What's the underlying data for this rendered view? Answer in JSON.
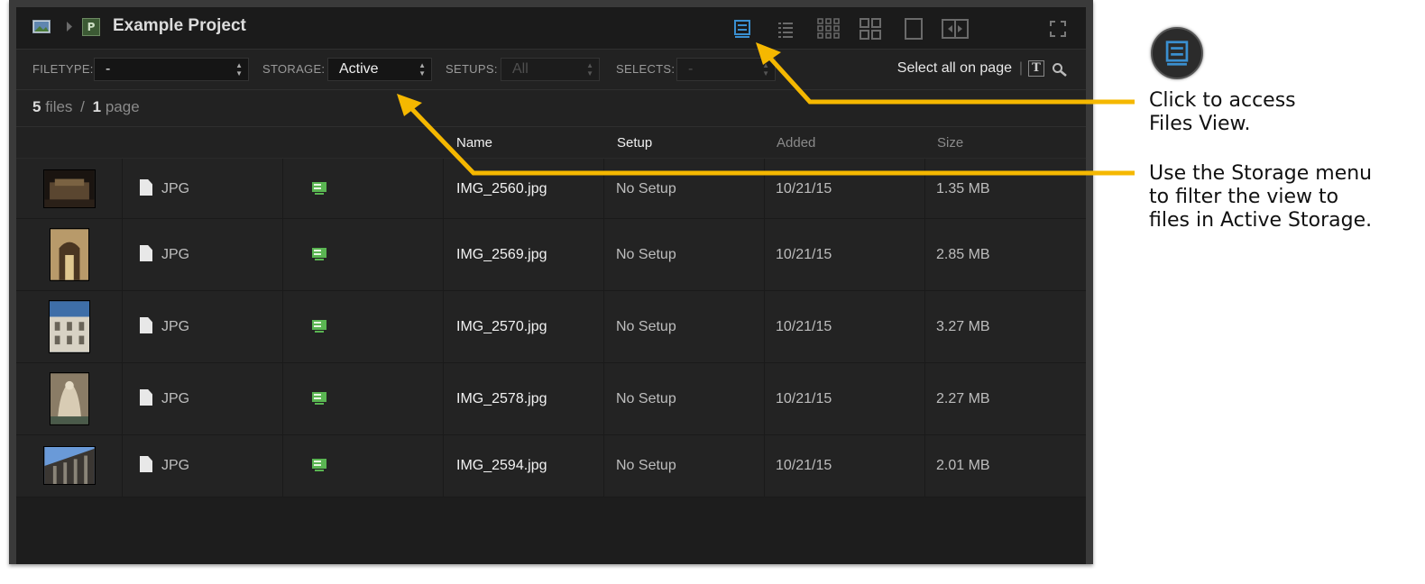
{
  "header": {
    "project_badge": "P",
    "title": "Example Project",
    "view_buttons": [
      "files-view-icon",
      "list-view-icon",
      "small-grid-icon",
      "large-grid-icon",
      "single-view-icon",
      "compare-view-icon"
    ],
    "fullscreen_icon": "fullscreen-icon"
  },
  "filters": {
    "filetype_label": "FILETYPE:",
    "filetype_value": "-",
    "storage_label": "STORAGE:",
    "storage_value": "Active",
    "setups_label": "SETUPS:",
    "setups_value": "All",
    "selects_label": "SELECTS:",
    "selects_value": "-",
    "select_all": "Select all on page",
    "separator": "|",
    "text_icon_glyph": "T"
  },
  "counts": {
    "files_num": "5",
    "files_word": "files",
    "slash": "/",
    "pages_num": "1",
    "pages_word": "page"
  },
  "table": {
    "columns": {
      "name": "Name",
      "setup": "Setup",
      "added": "Added",
      "size": "Size"
    },
    "rows": [
      {
        "type": "JPG",
        "name": "IMG_2560.jpg",
        "setup": "No Setup",
        "added": "10/21/15",
        "size": "1.35 MB"
      },
      {
        "type": "JPG",
        "name": "IMG_2569.jpg",
        "setup": "No Setup",
        "added": "10/21/15",
        "size": "2.85 MB"
      },
      {
        "type": "JPG",
        "name": "IMG_2570.jpg",
        "setup": "No Setup",
        "added": "10/21/15",
        "size": "3.27 MB"
      },
      {
        "type": "JPG",
        "name": "IMG_2578.jpg",
        "setup": "No Setup",
        "added": "10/21/15",
        "size": "2.27 MB"
      },
      {
        "type": "JPG",
        "name": "IMG_2594.jpg",
        "setup": "No Setup",
        "added": "10/21/15",
        "size": "2.01 MB"
      }
    ]
  },
  "annotations": {
    "files_view": "Click to access\nFiles View.",
    "storage_menu": "Use the Storage menu\nto filter the view to\nfiles in Active Storage."
  },
  "colors": {
    "accent_blue": "#3a8fd0",
    "callout_arrow": "#f5b800",
    "storage_green": "#5ab552"
  }
}
